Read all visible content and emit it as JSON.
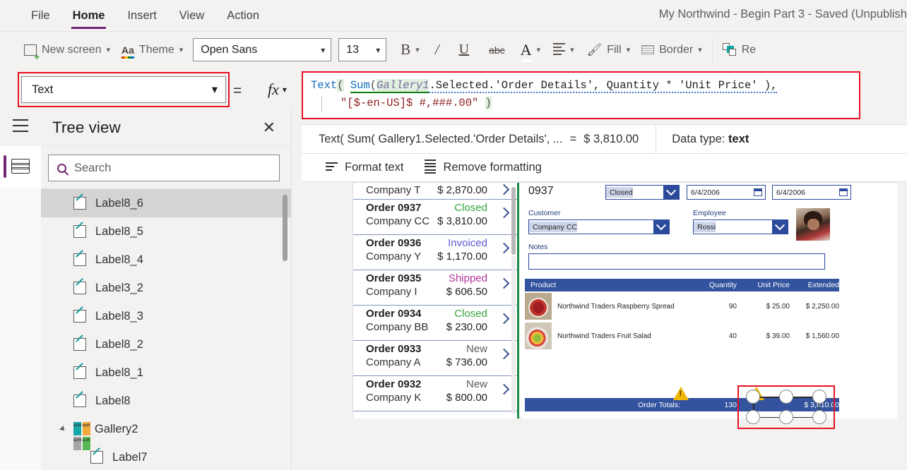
{
  "menu": {
    "items": [
      {
        "label": "File",
        "active": false
      },
      {
        "label": "Home",
        "active": true
      },
      {
        "label": "Insert",
        "active": false
      },
      {
        "label": "View",
        "active": false
      },
      {
        "label": "Action",
        "active": false
      }
    ],
    "app_title": "My Northwind - Begin Part 3 - Saved (Unpublish"
  },
  "ribbon": {
    "new_screen": "New screen",
    "theme": "Theme",
    "font_family": "Open Sans",
    "font_size": "13",
    "bold": "B",
    "italic": "I",
    "underline": "U",
    "strikethrough": "abc",
    "font_color": "A",
    "align": "align",
    "fill": "Fill",
    "border": "Border",
    "reorder": "Re"
  },
  "formula_bar": {
    "property": "Text",
    "equals": "=",
    "fx": "fx",
    "formula_line1_fn": "Text",
    "formula_line1_open": "(",
    "formula_sum": "Sum",
    "formula_sum_open": "(",
    "formula_gallery": "Gallery1",
    "formula_rest": ".Selected.'Order Details', Quantity * 'Unit Price' ),",
    "formula_line2": "\"[$-en-US]$ #,###.00\"",
    "formula_line2_close": ")"
  },
  "result_bar": {
    "expression": "Text( Sum( Gallery1.Selected.'Order Details', ...",
    "equals": "=",
    "value": "$ 3,810.00",
    "data_type_label": "Data type:",
    "data_type_value": "text",
    "format_text": "Format text",
    "remove_formatting": "Remove formatting"
  },
  "tree_view": {
    "title": "Tree view",
    "search_placeholder": "Search",
    "items": [
      {
        "label": "Label8_6",
        "type": "label",
        "selected": true,
        "indent": 0
      },
      {
        "label": "Label8_5",
        "type": "label",
        "selected": false,
        "indent": 0
      },
      {
        "label": "Label8_4",
        "type": "label",
        "selected": false,
        "indent": 0
      },
      {
        "label": "Label3_2",
        "type": "label",
        "selected": false,
        "indent": 0
      },
      {
        "label": "Label8_3",
        "type": "label",
        "selected": false,
        "indent": 0
      },
      {
        "label": "Label8_2",
        "type": "label",
        "selected": false,
        "indent": 0
      },
      {
        "label": "Label8_1",
        "type": "label",
        "selected": false,
        "indent": 0
      },
      {
        "label": "Label8",
        "type": "label",
        "selected": false,
        "indent": 0
      },
      {
        "label": "Gallery2",
        "type": "gallery",
        "selected": false,
        "indent": -1
      },
      {
        "label": "Label7",
        "type": "label",
        "selected": false,
        "indent": 1
      }
    ]
  },
  "canvas": {
    "gallery": {
      "partial_row": {
        "company": "Company T",
        "amount": "$ 2,870.00"
      },
      "rows": [
        {
          "order": "Order 0937",
          "status": "Closed",
          "company": "Company CC",
          "amount": "$ 3,810.00"
        },
        {
          "order": "Order 0936",
          "status": "Invoiced",
          "company": "Company Y",
          "amount": "$ 1,170.00"
        },
        {
          "order": "Order 0935",
          "status": "Shipped",
          "company": "Company I",
          "amount": "$ 606.50"
        },
        {
          "order": "Order 0934",
          "status": "Closed",
          "company": "Company BB",
          "amount": "$ 230.00"
        },
        {
          "order": "Order 0933",
          "status": "New",
          "company": "Company A",
          "amount": "$ 736.00"
        },
        {
          "order": "Order 0932",
          "status": "New",
          "company": "Company K",
          "amount": "$ 800.00"
        }
      ]
    },
    "detail": {
      "order_number": "0937",
      "status": "Closed",
      "date1": "6/4/2006",
      "date2": "6/4/2006",
      "customer_label": "Customer",
      "customer_value": "Company CC",
      "employee_label": "Employee",
      "employee_value": "Rossi",
      "notes_label": "Notes",
      "notes_value": "",
      "table": {
        "headers": [
          "Product",
          "Quantity",
          "Unit Price",
          "Extended"
        ],
        "rows": [
          {
            "product": "Northwind Traders Raspberry Spread",
            "quantity": "90",
            "unit_price": "$ 25.00",
            "extended": "$ 2,250.00"
          },
          {
            "product": "Northwind Traders Fruit Salad",
            "quantity": "40",
            "unit_price": "$ 39.00",
            "extended": "$ 1,560.00"
          }
        ]
      },
      "totals": {
        "label": "Order Totals:",
        "quantity": "130",
        "extended": "$ 3,810.00"
      }
    }
  },
  "colors": {
    "accent_purple": "#742774",
    "highlight_red": "#e81123",
    "table_blue": "#33539e",
    "status_closed": "#3aa43a",
    "status_invoiced": "#5b5bd6",
    "status_shipped": "#b4369b",
    "status_new": "#5a5a5a",
    "warning_yellow": "#f2b705",
    "gallery_border_green": "#1e8a4a"
  }
}
